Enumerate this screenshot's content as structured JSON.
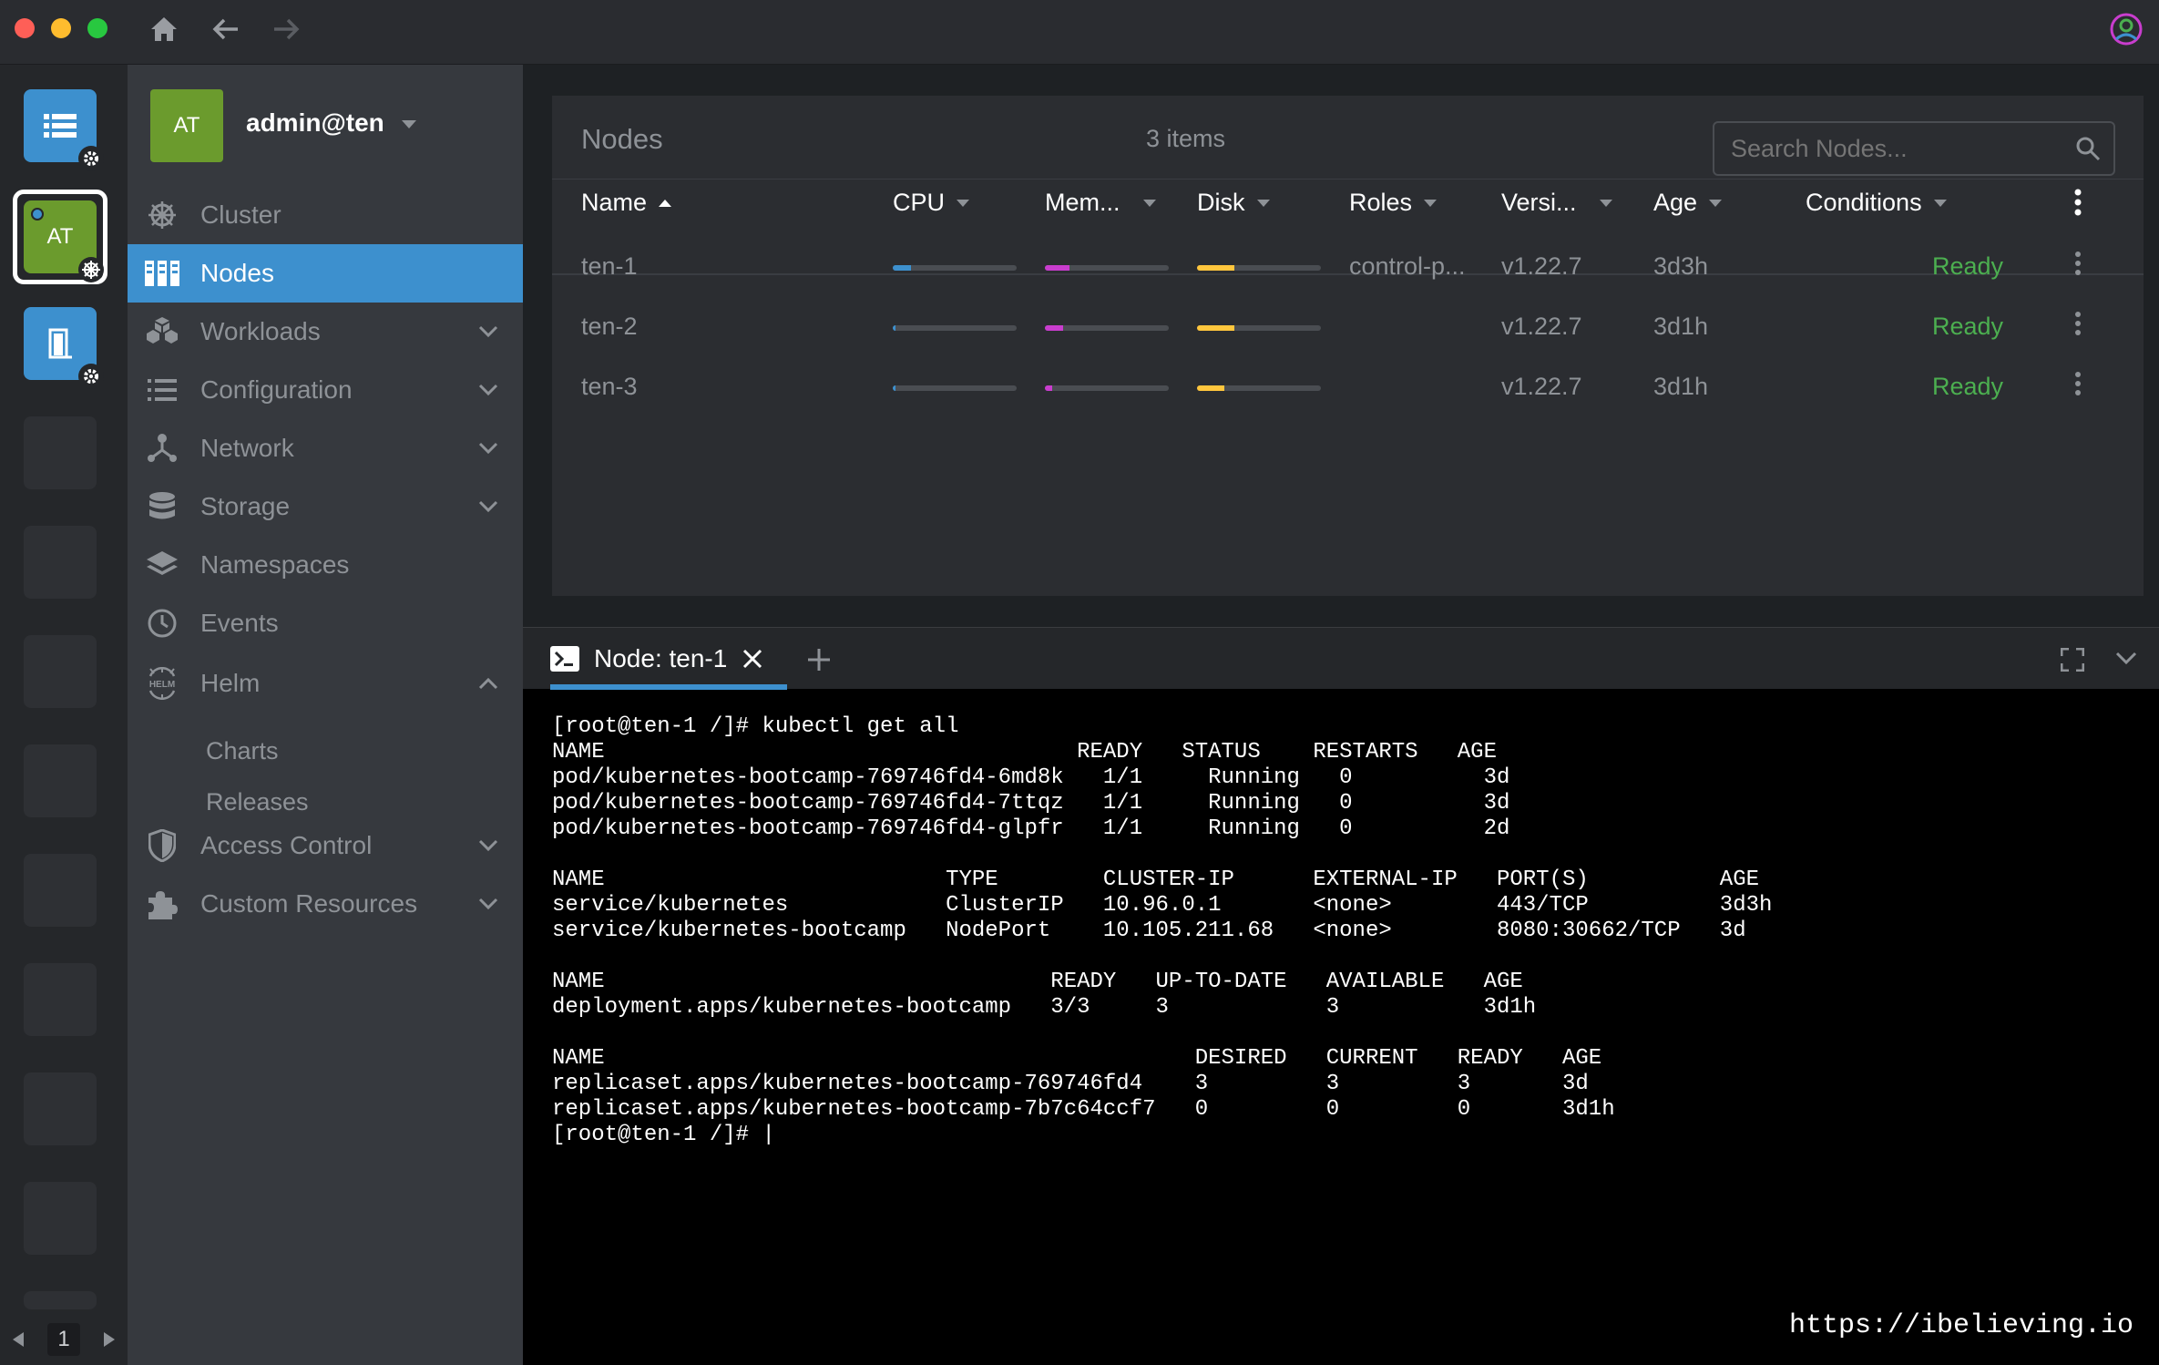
{
  "window": {
    "traffic_colors": [
      "#fe5f57",
      "#febc2e",
      "#28c840"
    ]
  },
  "hotbar": {
    "cluster_initials": "AT",
    "page": "1"
  },
  "sidebar": {
    "cluster_initials": "AT",
    "cluster_name": "admin@ten",
    "items": [
      {
        "label": "Cluster",
        "icon": "helm-wheel-icon"
      },
      {
        "label": "Nodes",
        "icon": "nodes-icon",
        "active": true
      },
      {
        "label": "Workloads",
        "icon": "cubes-icon"
      },
      {
        "label": "Configuration",
        "icon": "list-icon"
      },
      {
        "label": "Network",
        "icon": "network-icon"
      },
      {
        "label": "Storage",
        "icon": "database-icon"
      },
      {
        "label": "Namespaces",
        "icon": "layers-icon"
      },
      {
        "label": "Events",
        "icon": "clock-icon"
      },
      {
        "label": "Helm",
        "icon": "helm-icon"
      },
      {
        "label": "Access Control",
        "icon": "shield-icon"
      },
      {
        "label": "Custom Resources",
        "icon": "puzzle-icon"
      }
    ],
    "helm_sub": [
      "Charts",
      "Releases"
    ]
  },
  "nodes": {
    "title": "Nodes",
    "count": "3 items",
    "search_placeholder": "Search Nodes...",
    "columns": [
      "Name",
      "CPU",
      "Mem...",
      "Disk",
      "Roles",
      "Versi...",
      "Age",
      "Conditions"
    ],
    "rows": [
      {
        "name": "ten-1",
        "cpu": 0.15,
        "mem": 0.2,
        "disk": 0.3,
        "roles": "control-p...",
        "version": "v1.22.7",
        "age": "3d3h",
        "condition": "Ready"
      },
      {
        "name": "ten-2",
        "cpu": 0.02,
        "mem": 0.15,
        "disk": 0.3,
        "roles": "",
        "version": "v1.22.7",
        "age": "3d1h",
        "condition": "Ready"
      },
      {
        "name": "ten-3",
        "cpu": 0.02,
        "mem": 0.06,
        "disk": 0.22,
        "roles": "",
        "version": "v1.22.7",
        "age": "3d1h",
        "condition": "Ready"
      }
    ],
    "colors": {
      "cpu": "#3d90ce",
      "mem": "#c93dce",
      "disk": "#ffc63d",
      "ready": "#4caf50"
    }
  },
  "dock": {
    "tab_label": "Node: ten-1",
    "terminal": "[root@ten-1 /]# kubectl get all\nNAME                                    READY   STATUS    RESTARTS   AGE\npod/kubernetes-bootcamp-769746fd4-6md8k   1/1     Running   0          3d\npod/kubernetes-bootcamp-769746fd4-7ttqz   1/1     Running   0          3d\npod/kubernetes-bootcamp-769746fd4-glpfr   1/1     Running   0          2d\n\nNAME                          TYPE        CLUSTER-IP      EXTERNAL-IP   PORT(S)          AGE\nservice/kubernetes            ClusterIP   10.96.0.1       <none>        443/TCP          3d3h\nservice/kubernetes-bootcamp   NodePort    10.105.211.68   <none>        8080:30662/TCP   3d\n\nNAME                                  READY   UP-TO-DATE   AVAILABLE   AGE\ndeployment.apps/kubernetes-bootcamp   3/3     3            3           3d1h\n\nNAME                                             DESIRED   CURRENT   READY   AGE\nreplicaset.apps/kubernetes-bootcamp-769746fd4    3         3         3       3d\nreplicaset.apps/kubernetes-bootcamp-7b7c64ccf7   0         0         0       3d1h\n[root@ten-1 /]# |",
    "watermark": "https://ibelieving.io"
  }
}
